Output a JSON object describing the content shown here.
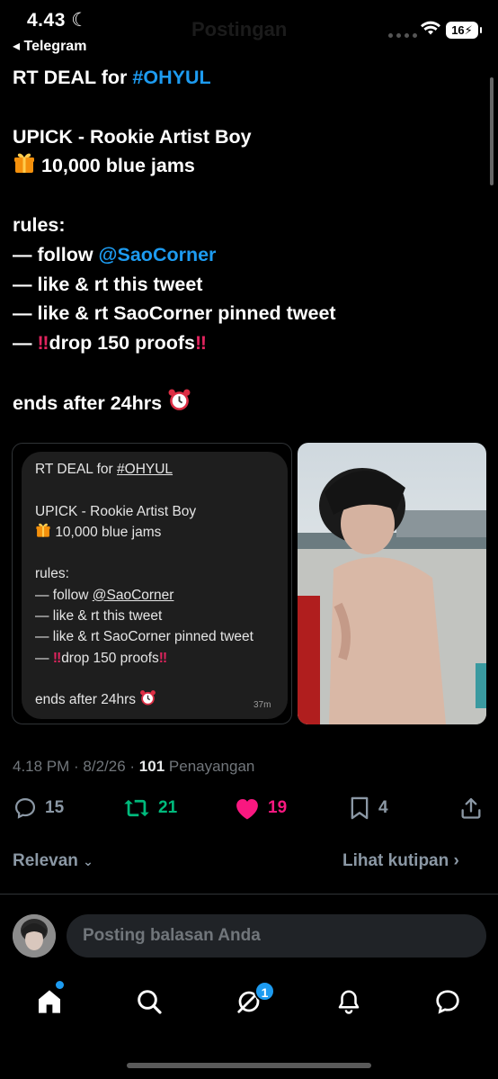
{
  "status": {
    "time": "4.43",
    "back_label": "◂ Telegram",
    "faded_title": "Postingan",
    "battery": "16"
  },
  "tweet": {
    "line1_prefix": "RT DEAL for ",
    "line1_tag": "#OHYUL",
    "line2": "UPICK - Rookie Artist Boy",
    "line3": "10,000 blue jams",
    "line4": "rules:",
    "line5_prefix": "— follow ",
    "line5_mention": "@SaoCorner",
    "line6": "— like & rt this tweet",
    "line7": "— like & rt SaoCorner pinned tweet",
    "line8_prefix": "— ",
    "line8_text": "drop 150 proofs",
    "line9": "ends after 24hrs"
  },
  "media": {
    "bubble_line1_prefix": "RT DEAL for ",
    "bubble_line1_tag": "#OHYUL",
    "bubble_line2": "UPICK - Rookie Artist Boy",
    "bubble_line3": "10,000 blue jams",
    "bubble_line4": "rules:",
    "bubble_line5_prefix": "— follow ",
    "bubble_line5_mention": "@SaoCorner",
    "bubble_line6": "— like & rt this tweet",
    "bubble_line7": "— like & rt SaoCorner pinned tweet",
    "bubble_line8_prefix": "— ",
    "bubble_line8_text": "drop 150 proofs",
    "bubble_line9": "ends after 24hrs",
    "bubble_time": "37m"
  },
  "meta": {
    "time": "4.18 PM",
    "sep1": " · ",
    "date": "8/2/26",
    "sep2": " · ",
    "views_count": "101",
    "views_label": " Penayangan"
  },
  "actions": {
    "replies": "15",
    "retweets": "21",
    "likes": "19",
    "bookmarks": "4"
  },
  "colors": {
    "retweet": "#00ba7c",
    "like": "#f91880",
    "accent": "#1d9bf0"
  },
  "sort": {
    "label": "Relevan",
    "quotes_label": "Lihat kutipan"
  },
  "reply_box": {
    "placeholder": "Posting balasan Anda"
  },
  "nav": {
    "items": [
      "home-icon",
      "search-icon",
      "grok-icon",
      "bell-icon",
      "messages-icon"
    ],
    "badge": "1"
  }
}
